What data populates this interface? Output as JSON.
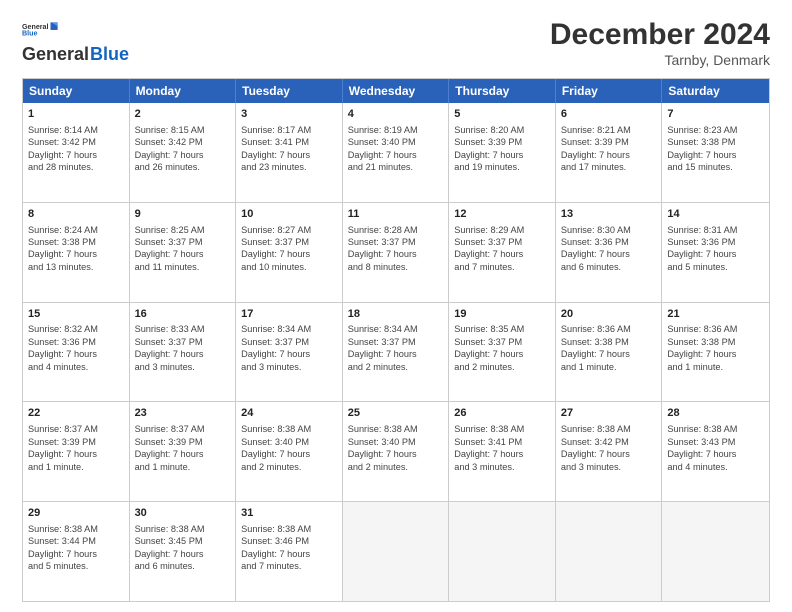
{
  "header": {
    "logo_line1": "General",
    "logo_line2": "Blue",
    "month": "December 2024",
    "location": "Tarnby, Denmark"
  },
  "days_of_week": [
    "Sunday",
    "Monday",
    "Tuesday",
    "Wednesday",
    "Thursday",
    "Friday",
    "Saturday"
  ],
  "weeks": [
    [
      {
        "day": 1,
        "info": "Sunrise: 8:14 AM\nSunset: 3:42 PM\nDaylight: 7 hours\nand 28 minutes."
      },
      {
        "day": 2,
        "info": "Sunrise: 8:15 AM\nSunset: 3:42 PM\nDaylight: 7 hours\nand 26 minutes."
      },
      {
        "day": 3,
        "info": "Sunrise: 8:17 AM\nSunset: 3:41 PM\nDaylight: 7 hours\nand 23 minutes."
      },
      {
        "day": 4,
        "info": "Sunrise: 8:19 AM\nSunset: 3:40 PM\nDaylight: 7 hours\nand 21 minutes."
      },
      {
        "day": 5,
        "info": "Sunrise: 8:20 AM\nSunset: 3:39 PM\nDaylight: 7 hours\nand 19 minutes."
      },
      {
        "day": 6,
        "info": "Sunrise: 8:21 AM\nSunset: 3:39 PM\nDaylight: 7 hours\nand 17 minutes."
      },
      {
        "day": 7,
        "info": "Sunrise: 8:23 AM\nSunset: 3:38 PM\nDaylight: 7 hours\nand 15 minutes."
      }
    ],
    [
      {
        "day": 8,
        "info": "Sunrise: 8:24 AM\nSunset: 3:38 PM\nDaylight: 7 hours\nand 13 minutes."
      },
      {
        "day": 9,
        "info": "Sunrise: 8:25 AM\nSunset: 3:37 PM\nDaylight: 7 hours\nand 11 minutes."
      },
      {
        "day": 10,
        "info": "Sunrise: 8:27 AM\nSunset: 3:37 PM\nDaylight: 7 hours\nand 10 minutes."
      },
      {
        "day": 11,
        "info": "Sunrise: 8:28 AM\nSunset: 3:37 PM\nDaylight: 7 hours\nand 8 minutes."
      },
      {
        "day": 12,
        "info": "Sunrise: 8:29 AM\nSunset: 3:37 PM\nDaylight: 7 hours\nand 7 minutes."
      },
      {
        "day": 13,
        "info": "Sunrise: 8:30 AM\nSunset: 3:36 PM\nDaylight: 7 hours\nand 6 minutes."
      },
      {
        "day": 14,
        "info": "Sunrise: 8:31 AM\nSunset: 3:36 PM\nDaylight: 7 hours\nand 5 minutes."
      }
    ],
    [
      {
        "day": 15,
        "info": "Sunrise: 8:32 AM\nSunset: 3:36 PM\nDaylight: 7 hours\nand 4 minutes."
      },
      {
        "day": 16,
        "info": "Sunrise: 8:33 AM\nSunset: 3:37 PM\nDaylight: 7 hours\nand 3 minutes."
      },
      {
        "day": 17,
        "info": "Sunrise: 8:34 AM\nSunset: 3:37 PM\nDaylight: 7 hours\nand 3 minutes."
      },
      {
        "day": 18,
        "info": "Sunrise: 8:34 AM\nSunset: 3:37 PM\nDaylight: 7 hours\nand 2 minutes."
      },
      {
        "day": 19,
        "info": "Sunrise: 8:35 AM\nSunset: 3:37 PM\nDaylight: 7 hours\nand 2 minutes."
      },
      {
        "day": 20,
        "info": "Sunrise: 8:36 AM\nSunset: 3:38 PM\nDaylight: 7 hours\nand 1 minute."
      },
      {
        "day": 21,
        "info": "Sunrise: 8:36 AM\nSunset: 3:38 PM\nDaylight: 7 hours\nand 1 minute."
      }
    ],
    [
      {
        "day": 22,
        "info": "Sunrise: 8:37 AM\nSunset: 3:39 PM\nDaylight: 7 hours\nand 1 minute."
      },
      {
        "day": 23,
        "info": "Sunrise: 8:37 AM\nSunset: 3:39 PM\nDaylight: 7 hours\nand 1 minute."
      },
      {
        "day": 24,
        "info": "Sunrise: 8:38 AM\nSunset: 3:40 PM\nDaylight: 7 hours\nand 2 minutes."
      },
      {
        "day": 25,
        "info": "Sunrise: 8:38 AM\nSunset: 3:40 PM\nDaylight: 7 hours\nand 2 minutes."
      },
      {
        "day": 26,
        "info": "Sunrise: 8:38 AM\nSunset: 3:41 PM\nDaylight: 7 hours\nand 3 minutes."
      },
      {
        "day": 27,
        "info": "Sunrise: 8:38 AM\nSunset: 3:42 PM\nDaylight: 7 hours\nand 3 minutes."
      },
      {
        "day": 28,
        "info": "Sunrise: 8:38 AM\nSunset: 3:43 PM\nDaylight: 7 hours\nand 4 minutes."
      }
    ],
    [
      {
        "day": 29,
        "info": "Sunrise: 8:38 AM\nSunset: 3:44 PM\nDaylight: 7 hours\nand 5 minutes."
      },
      {
        "day": 30,
        "info": "Sunrise: 8:38 AM\nSunset: 3:45 PM\nDaylight: 7 hours\nand 6 minutes."
      },
      {
        "day": 31,
        "info": "Sunrise: 8:38 AM\nSunset: 3:46 PM\nDaylight: 7 hours\nand 7 minutes."
      },
      null,
      null,
      null,
      null
    ]
  ]
}
